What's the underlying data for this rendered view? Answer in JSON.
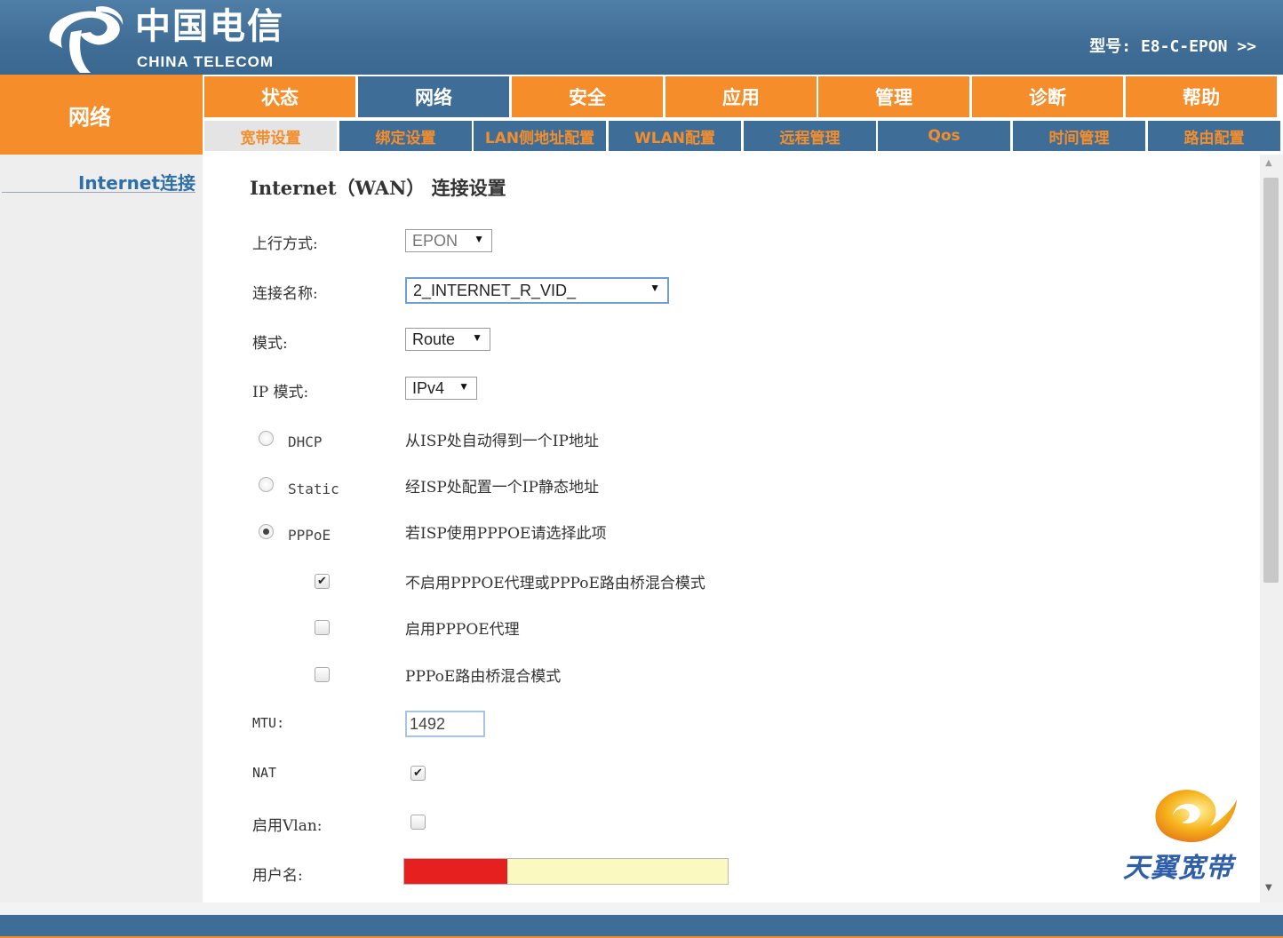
{
  "header": {
    "logo_cn": "中国电信",
    "logo_en": "CHINA TELECOM",
    "model_info": "型号: E8-C-EPON >>"
  },
  "nav_label": "网络",
  "main_tabs": [
    "状态",
    "网络",
    "安全",
    "应用",
    "管理",
    "诊断",
    "帮助"
  ],
  "main_tab_active": "网络",
  "sub_tabs": [
    "宽带设置",
    "绑定设置",
    "LAN侧地址配置",
    "WLAN配置",
    "远程管理",
    "Qos",
    "时间管理",
    "路由配置"
  ],
  "sub_tab_active": "宽带设置",
  "sidebar": {
    "item": "Internet连接"
  },
  "page_title": "Internet（WAN） 连接设置",
  "form": {
    "uplink_label": "上行方式:",
    "uplink_value": "EPON",
    "conn_name_label": "连接名称:",
    "conn_name_value": "2_INTERNET_R_VID_",
    "mode_label": "模式:",
    "mode_value": "Route",
    "ip_mode_label": "IP 模式:",
    "ip_mode_value": "IPv4",
    "radios": [
      {
        "label": "DHCP",
        "desc": "从ISP处自动得到一个IP地址",
        "checked": false
      },
      {
        "label": "Static",
        "desc": "经ISP处配置一个IP静态地址",
        "checked": false
      },
      {
        "label": "PPPoE",
        "desc": "若ISP使用PPPOE请选择此项",
        "checked": true
      }
    ],
    "pppoe_options": [
      {
        "desc": "不启用PPPOE代理或PPPoE路由桥混合模式",
        "checked": true
      },
      {
        "desc": "启用PPPOE代理",
        "checked": false
      },
      {
        "desc": "PPPoE路由桥混合模式",
        "checked": false
      }
    ],
    "mtu_label": "MTU:",
    "mtu_value": "1492",
    "nat_label": "NAT",
    "nat_checked": true,
    "vlan_label": "启用Vlan:",
    "vlan_checked": false,
    "username_label": "用户名:"
  },
  "brand": {
    "text": "天翼宽带"
  },
  "colors": {
    "orange": "#f48d2a",
    "blue": "#3e6e98",
    "redaction": "#e5201f"
  },
  "icons": {
    "dropdown": "▼",
    "check": "✔",
    "scroll_up": "▲",
    "scroll_down": "▼"
  }
}
